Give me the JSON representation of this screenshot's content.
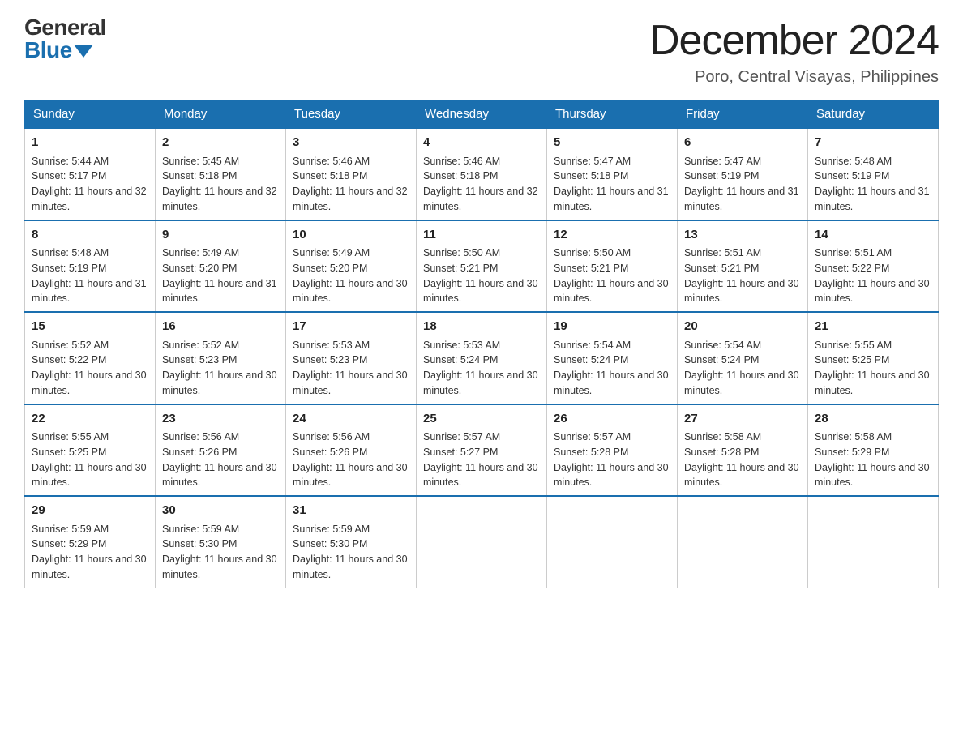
{
  "logo": {
    "general": "General",
    "blue": "Blue"
  },
  "title": "December 2024",
  "location": "Poro, Central Visayas, Philippines",
  "headers": [
    "Sunday",
    "Monday",
    "Tuesday",
    "Wednesday",
    "Thursday",
    "Friday",
    "Saturday"
  ],
  "weeks": [
    [
      {
        "day": "1",
        "sunrise": "5:44 AM",
        "sunset": "5:17 PM",
        "daylight": "11 hours and 32 minutes."
      },
      {
        "day": "2",
        "sunrise": "5:45 AM",
        "sunset": "5:18 PM",
        "daylight": "11 hours and 32 minutes."
      },
      {
        "day": "3",
        "sunrise": "5:46 AM",
        "sunset": "5:18 PM",
        "daylight": "11 hours and 32 minutes."
      },
      {
        "day": "4",
        "sunrise": "5:46 AM",
        "sunset": "5:18 PM",
        "daylight": "11 hours and 32 minutes."
      },
      {
        "day": "5",
        "sunrise": "5:47 AM",
        "sunset": "5:18 PM",
        "daylight": "11 hours and 31 minutes."
      },
      {
        "day": "6",
        "sunrise": "5:47 AM",
        "sunset": "5:19 PM",
        "daylight": "11 hours and 31 minutes."
      },
      {
        "day": "7",
        "sunrise": "5:48 AM",
        "sunset": "5:19 PM",
        "daylight": "11 hours and 31 minutes."
      }
    ],
    [
      {
        "day": "8",
        "sunrise": "5:48 AM",
        "sunset": "5:19 PM",
        "daylight": "11 hours and 31 minutes."
      },
      {
        "day": "9",
        "sunrise": "5:49 AM",
        "sunset": "5:20 PM",
        "daylight": "11 hours and 31 minutes."
      },
      {
        "day": "10",
        "sunrise": "5:49 AM",
        "sunset": "5:20 PM",
        "daylight": "11 hours and 30 minutes."
      },
      {
        "day": "11",
        "sunrise": "5:50 AM",
        "sunset": "5:21 PM",
        "daylight": "11 hours and 30 minutes."
      },
      {
        "day": "12",
        "sunrise": "5:50 AM",
        "sunset": "5:21 PM",
        "daylight": "11 hours and 30 minutes."
      },
      {
        "day": "13",
        "sunrise": "5:51 AM",
        "sunset": "5:21 PM",
        "daylight": "11 hours and 30 minutes."
      },
      {
        "day": "14",
        "sunrise": "5:51 AM",
        "sunset": "5:22 PM",
        "daylight": "11 hours and 30 minutes."
      }
    ],
    [
      {
        "day": "15",
        "sunrise": "5:52 AM",
        "sunset": "5:22 PM",
        "daylight": "11 hours and 30 minutes."
      },
      {
        "day": "16",
        "sunrise": "5:52 AM",
        "sunset": "5:23 PM",
        "daylight": "11 hours and 30 minutes."
      },
      {
        "day": "17",
        "sunrise": "5:53 AM",
        "sunset": "5:23 PM",
        "daylight": "11 hours and 30 minutes."
      },
      {
        "day": "18",
        "sunrise": "5:53 AM",
        "sunset": "5:24 PM",
        "daylight": "11 hours and 30 minutes."
      },
      {
        "day": "19",
        "sunrise": "5:54 AM",
        "sunset": "5:24 PM",
        "daylight": "11 hours and 30 minutes."
      },
      {
        "day": "20",
        "sunrise": "5:54 AM",
        "sunset": "5:24 PM",
        "daylight": "11 hours and 30 minutes."
      },
      {
        "day": "21",
        "sunrise": "5:55 AM",
        "sunset": "5:25 PM",
        "daylight": "11 hours and 30 minutes."
      }
    ],
    [
      {
        "day": "22",
        "sunrise": "5:55 AM",
        "sunset": "5:25 PM",
        "daylight": "11 hours and 30 minutes."
      },
      {
        "day": "23",
        "sunrise": "5:56 AM",
        "sunset": "5:26 PM",
        "daylight": "11 hours and 30 minutes."
      },
      {
        "day": "24",
        "sunrise": "5:56 AM",
        "sunset": "5:26 PM",
        "daylight": "11 hours and 30 minutes."
      },
      {
        "day": "25",
        "sunrise": "5:57 AM",
        "sunset": "5:27 PM",
        "daylight": "11 hours and 30 minutes."
      },
      {
        "day": "26",
        "sunrise": "5:57 AM",
        "sunset": "5:28 PM",
        "daylight": "11 hours and 30 minutes."
      },
      {
        "day": "27",
        "sunrise": "5:58 AM",
        "sunset": "5:28 PM",
        "daylight": "11 hours and 30 minutes."
      },
      {
        "day": "28",
        "sunrise": "5:58 AM",
        "sunset": "5:29 PM",
        "daylight": "11 hours and 30 minutes."
      }
    ],
    [
      {
        "day": "29",
        "sunrise": "5:59 AM",
        "sunset": "5:29 PM",
        "daylight": "11 hours and 30 minutes."
      },
      {
        "day": "30",
        "sunrise": "5:59 AM",
        "sunset": "5:30 PM",
        "daylight": "11 hours and 30 minutes."
      },
      {
        "day": "31",
        "sunrise": "5:59 AM",
        "sunset": "5:30 PM",
        "daylight": "11 hours and 30 minutes."
      },
      null,
      null,
      null,
      null
    ]
  ]
}
